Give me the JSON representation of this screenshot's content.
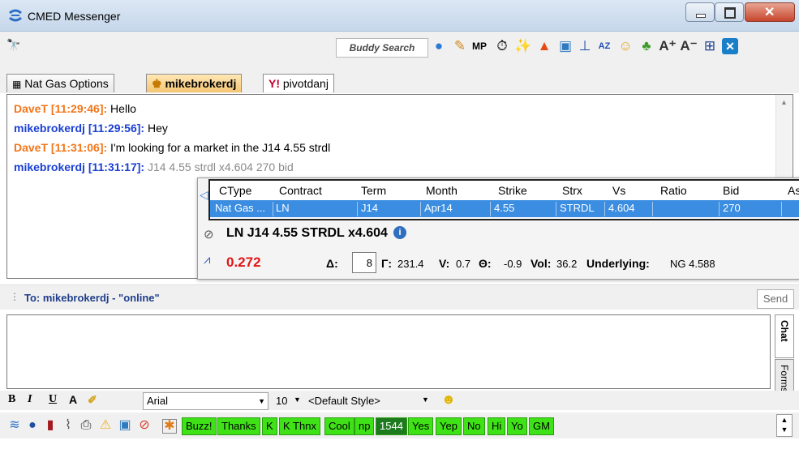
{
  "window": {
    "title": "CMED Messenger"
  },
  "toolbar": {
    "buddy_search": "Buddy Search",
    "mp_label": "MP",
    "icons": [
      "globe-icon",
      "wrench-icon",
      "mp-icon",
      "timer-icon",
      "magic-wand-icon",
      "warning-icon",
      "image-icon",
      "pin-icon",
      "sort-az-icon",
      "emoticon-icon",
      "users-icon",
      "font-increase-icon",
      "font-decrease-icon",
      "layout-icon",
      "close-x-icon"
    ]
  },
  "tabs": [
    {
      "label": "Nat Gas Options"
    },
    {
      "label": "mikebrokerdj"
    },
    {
      "label": "pivotdanj"
    }
  ],
  "history": [
    {
      "who": "DaveT [11:29:46]:",
      "text": " Hello",
      "kind": "dave"
    },
    {
      "who": "mikebrokerdj [11:29:56]:",
      "text": " Hey",
      "kind": "mike"
    },
    {
      "who": "DaveT [11:31:06]:",
      "text": " I'm looking for a market in the J14 4.55 strdl",
      "kind": "dave"
    },
    {
      "who": "mikebrokerdj [11:31:17]:",
      "text": " J14 4.55 strdl x4.604 270 bid",
      "kind": "mike"
    }
  ],
  "quote": {
    "headers": [
      "CType",
      "Contract",
      "Term",
      "Month",
      "Strike",
      "Strx",
      "Vs",
      "Ratio",
      "Bid",
      "Ask"
    ],
    "row": [
      "Nat Gas ...",
      "LN",
      "J14",
      "Apr14",
      "4.55",
      "STRDL",
      "4.604",
      "",
      "270",
      ""
    ],
    "summary": "LN J14 4.55 STRDL x4.604",
    "price": "0.272",
    "delta_label": "Δ:",
    "delta_value": "8",
    "gamma_label": "Γ:",
    "gamma_value": "231.4",
    "vega_label": "V:",
    "vega_value": "0.7",
    "theta_label": "Θ:",
    "theta_value": "-0.9",
    "vol_label": "Vol:",
    "vol_value": "36.2",
    "underlying_label": "Underlying:",
    "underlying_value": "NG 4.588"
  },
  "compose": {
    "to_label": "To: mikebrokerdj  - \"online\"",
    "send": "Send",
    "side_chat": "Chat",
    "side_forms": "Forms",
    "font": "Arial",
    "size": "10",
    "style": "<Default Style>"
  },
  "quick_buttons": [
    "Buzz!",
    "Thanks",
    "K",
    "K Thnx",
    "Cool",
    "np",
    "1544",
    "Yes",
    "Yep",
    "No",
    "Hi",
    "Yo",
    "GM"
  ],
  "colors": {
    "dave": "#f2761a",
    "mike": "#1a3fd4",
    "quick": "#3fe216",
    "selected_row": "#3a8de0"
  }
}
